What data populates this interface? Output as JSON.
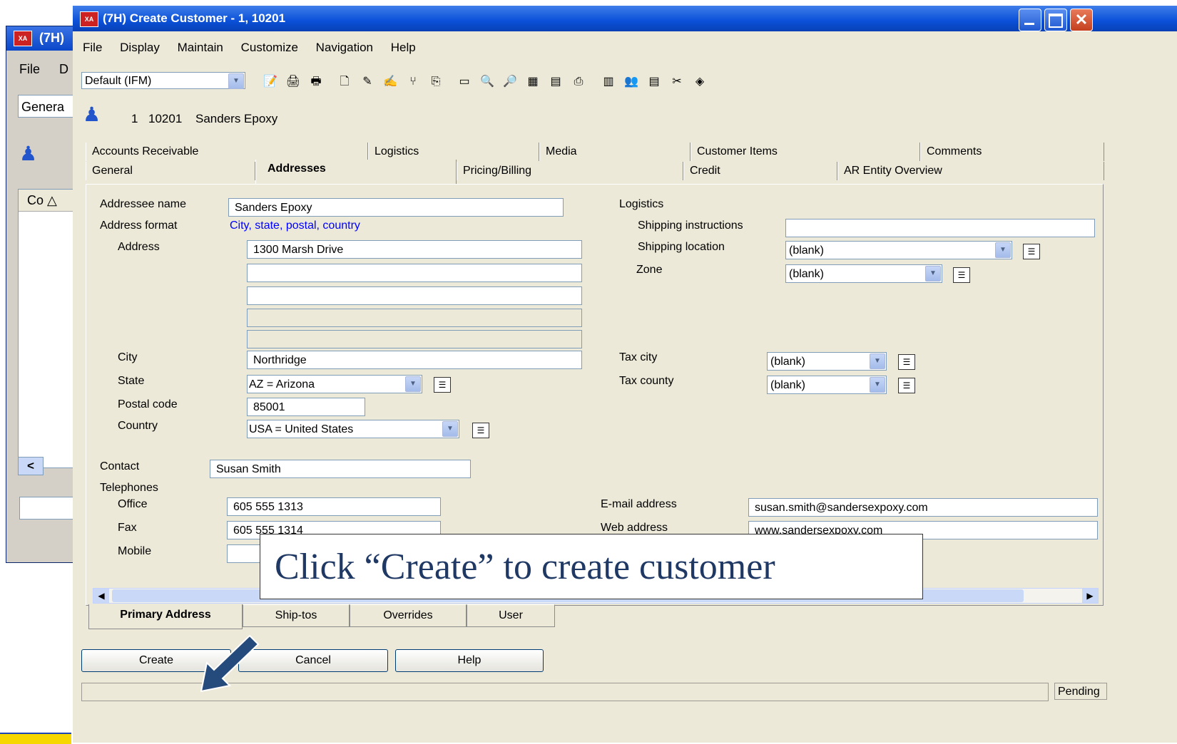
{
  "bg_window": {
    "title": "(7H)",
    "menu_file": "File",
    "menu_d": "D",
    "combo_value": "Genera",
    "col_header": "Co"
  },
  "window": {
    "title": "(7H) Create Customer - 1, 10201",
    "app_icon": "XA"
  },
  "menu": [
    "File",
    "Display",
    "Maintain",
    "Customize",
    "Navigation",
    "Help"
  ],
  "toolbar": {
    "view_select": "Default (IFM)"
  },
  "header": {
    "company": "1",
    "customer_no": "10201",
    "customer_name": "Sanders Epoxy"
  },
  "tabs_row1": [
    "Accounts Receivable",
    "Logistics",
    "Media",
    "Customer Items",
    "Comments"
  ],
  "tabs_row2": [
    "General",
    "Addresses",
    "Pricing/Billing",
    "Credit",
    "AR Entity Overview"
  ],
  "form": {
    "addressee_label": "Addressee name",
    "addressee_value": "Sanders Epoxy",
    "format_label": "Address format",
    "format_value": "City, state, postal, country",
    "address_label": "Address",
    "address_line1": "1300 Marsh Drive",
    "city_label": "City",
    "city_value": "Northridge",
    "state_label": "State",
    "state_value": "AZ = Arizona",
    "postal_label": "Postal code",
    "postal_value": "85001",
    "country_label": "Country",
    "country_value": "USA = United States",
    "contact_label": "Contact",
    "contact_value": "Susan Smith",
    "telephones_label": "Telephones",
    "office_label": "Office",
    "office_value": "605 555 1313",
    "fax_label": "Fax",
    "fax_value": "605 555 1314",
    "mobile_label": "Mobile",
    "logistics_label": "Logistics",
    "ship_instr_label": "Shipping instructions",
    "ship_loc_label": "Shipping location",
    "ship_loc_value": "(blank)",
    "zone_label": "Zone",
    "zone_value": "(blank)",
    "tax_city_label": "Tax city",
    "tax_city_value": "(blank)",
    "tax_county_label": "Tax county",
    "tax_county_value": "(blank)",
    "email_label": "E-mail address",
    "email_value": "susan.smith@sandersexpoxy.com",
    "web_label": "Web address",
    "web_value": "www.sandersexpoxy.com"
  },
  "bottom_tabs": [
    "Primary Address",
    "Ship-tos",
    "Overrides",
    "User"
  ],
  "buttons": {
    "create": "Create",
    "cancel": "Cancel",
    "help": "Help"
  },
  "status": "Pending",
  "callout": "Click “Create” to create customer",
  "colors": {
    "title_bar": "#0a50d8",
    "window_bg": "#ece9d8",
    "link_blue": "#0000ff",
    "callout_text": "#1f3864",
    "arrow": "#254a7c"
  }
}
